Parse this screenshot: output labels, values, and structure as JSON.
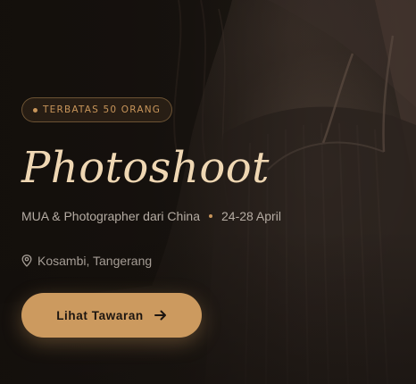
{
  "hero": {
    "badge": "TERBATAS 50 ORANG",
    "title": "Photoshoot",
    "subtitle_service": "MUA & Photographer dari China",
    "subtitle_dates": "24-28 April",
    "location": "Kosambi, Tangerang",
    "cta_label": "Lihat Tawaran"
  },
  "icons": {
    "location": "map-pin-icon",
    "cta": "arrow-right-icon"
  },
  "colors": {
    "accent": "#c8955a",
    "button": "#cc9a5f",
    "title": "#efd7b3",
    "text_muted": "#b5aca3",
    "background": "#1c1713"
  }
}
